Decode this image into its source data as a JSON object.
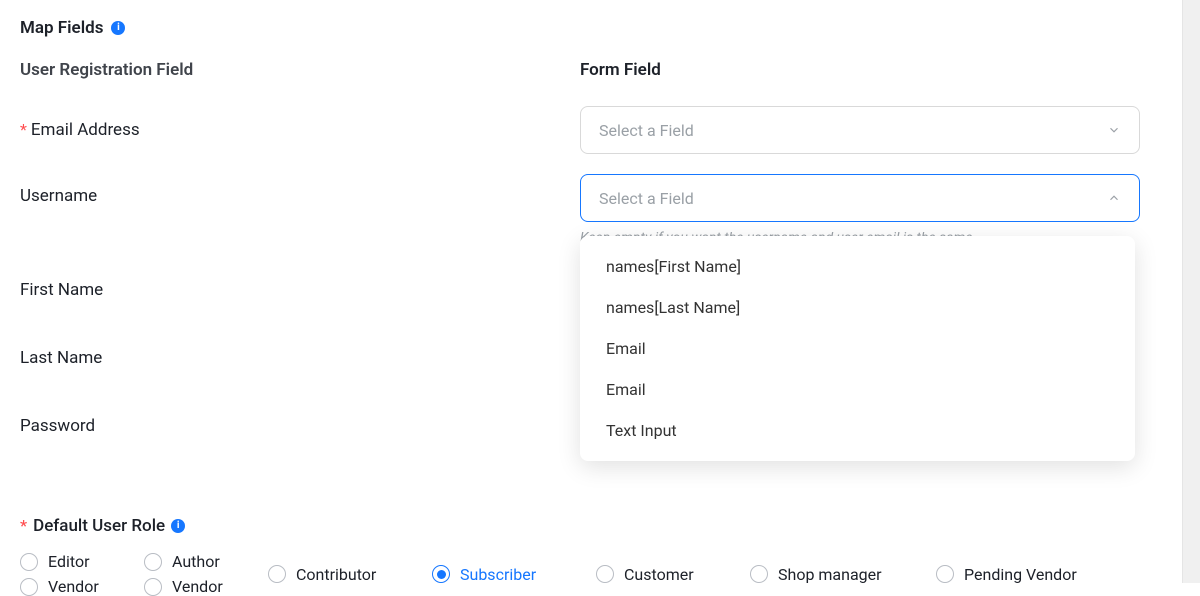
{
  "section_title": "Map Fields",
  "columns": {
    "left": "User Registration Field",
    "right": "Form Field"
  },
  "select_placeholder": "Select a Field",
  "fields": {
    "email": {
      "label": "Email Address",
      "required": true
    },
    "username": {
      "label": "Username",
      "helper": "Keep empty if you want the username and user email is the same"
    },
    "firstname": {
      "label": "First Name"
    },
    "lastname": {
      "label": "Last Name"
    },
    "password": {
      "label": "Password"
    }
  },
  "dropdown_options": [
    "names[First Name]",
    "names[Last Name]",
    "Email",
    "Email",
    "Text Input"
  ],
  "role": {
    "label": "Default User Role",
    "required": true,
    "selected": "Subscriber",
    "options": [
      "Editor",
      "Author",
      "Contributor",
      "Subscriber",
      "Customer",
      "Shop manager",
      "Pending Vendor",
      "Vendor",
      "Vendor"
    ]
  }
}
